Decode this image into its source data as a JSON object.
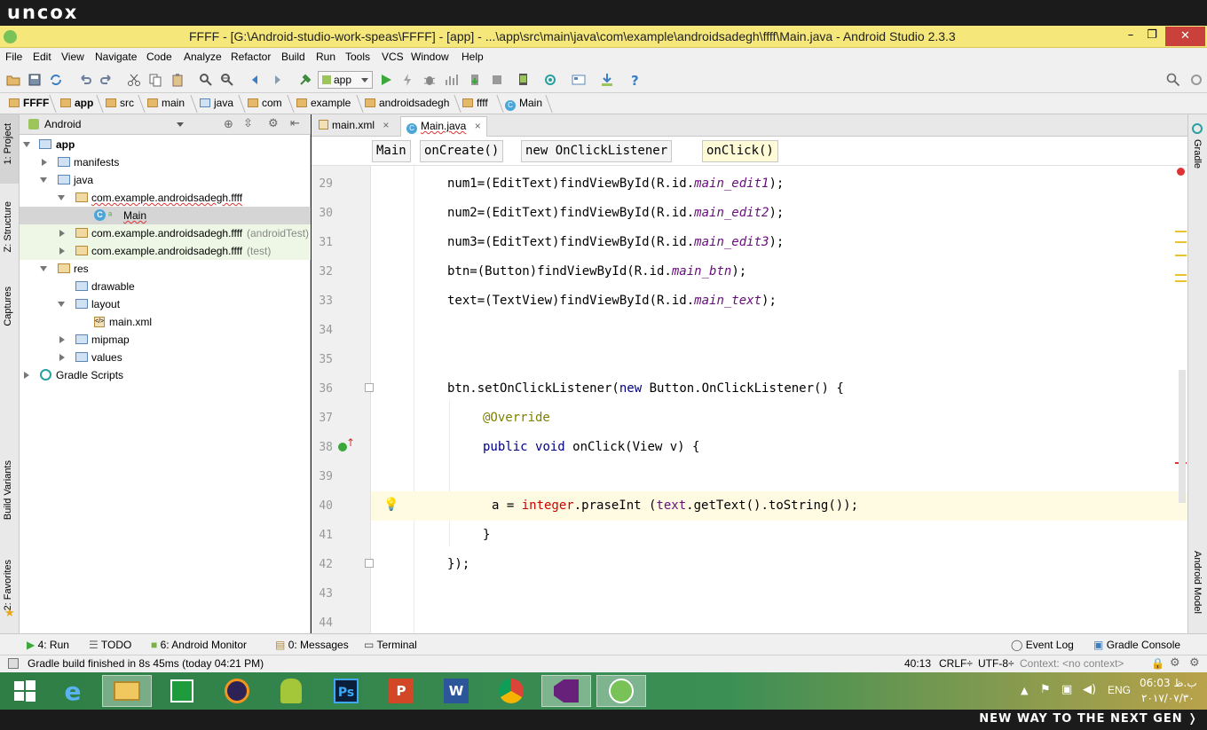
{
  "brand": {
    "logo": "uncox",
    "tagline": "NEW WAY TO THE NEXT GEN ❭"
  },
  "window": {
    "title": "FFFF - [G:\\Android-studio-work-speas\\FFFF] - [app] - ...\\app\\src\\main\\java\\com\\example\\androidsadegh\\ffff\\Main.java - Android Studio 2.3.3",
    "minimize": "–",
    "maximize": "❐",
    "close": "✕"
  },
  "menu": [
    "File",
    "Edit",
    "View",
    "Navigate",
    "Code",
    "Analyze",
    "Refactor",
    "Build",
    "Run",
    "Tools",
    "VCS",
    "Window",
    "Help"
  ],
  "toolbar": {
    "run_config": "app"
  },
  "nav_breadcrumb": [
    "FFFF",
    "app",
    "src",
    "main",
    "java",
    "com",
    "example",
    "androidsadegh",
    "ffff",
    "Main"
  ],
  "left_strip": {
    "project": "1: Project",
    "structure": "Z: Structure",
    "captures": "Captures",
    "build_variants": "Build Variants",
    "favorites": "2: Favorites"
  },
  "right_strip": {
    "gradle": "Gradle",
    "android_model": "Android Model"
  },
  "project_panel": {
    "view_mode": "Android",
    "tree": [
      {
        "label": "app",
        "suffix": ""
      },
      {
        "label": "manifests",
        "suffix": ""
      },
      {
        "label": "java",
        "suffix": ""
      },
      {
        "label": "com.example.androidsadegh.ffff",
        "suffix": ""
      },
      {
        "label": "Main",
        "suffix": ""
      },
      {
        "label": "com.example.androidsadegh.ffff",
        "suffix": "(androidTest)"
      },
      {
        "label": "com.example.androidsadegh.ffff",
        "suffix": "(test)"
      },
      {
        "label": "res",
        "suffix": ""
      },
      {
        "label": "drawable",
        "suffix": ""
      },
      {
        "label": "layout",
        "suffix": ""
      },
      {
        "label": "main.xml",
        "suffix": ""
      },
      {
        "label": "mipmap",
        "suffix": ""
      },
      {
        "label": "values",
        "suffix": ""
      },
      {
        "label": "Gradle Scripts",
        "suffix": ""
      }
    ]
  },
  "editor_tabs": [
    {
      "label": "main.xml",
      "close": "×"
    },
    {
      "label": "Main.java",
      "close": "×"
    }
  ],
  "code_breadcrumb": [
    "Main",
    "onCreate()",
    "new OnClickListener",
    "onClick()"
  ],
  "code": {
    "line_numbers": [
      "29",
      "30",
      "31",
      "32",
      "33",
      "34",
      "35",
      "36",
      "37",
      "38",
      "39",
      "40",
      "41",
      "42",
      "43",
      "44"
    ],
    "l29": {
      "a": "num1=(EditText)findViewById(R.id.",
      "b": "main_edit1",
      "c": ");"
    },
    "l30": {
      "a": "num2=(EditText)findViewById(R.id.",
      "b": "main_edit2",
      "c": ");"
    },
    "l31": {
      "a": "num3=(EditText)findViewById(R.id.",
      "b": "main_edit3",
      "c": ");"
    },
    "l32": {
      "a": "btn=(Button)findViewById(R.id.",
      "b": "main_btn",
      "c": ");"
    },
    "l33": {
      "a": "text=(TextView)findViewById(R.id.",
      "b": "main_text",
      "c": ");"
    },
    "l36": {
      "a": "btn.setOnClickListener(",
      "kw": "new",
      "b": " Button.OnClickListener() {"
    },
    "l37": "@Override",
    "l38": {
      "kw1": "public",
      "kw2": "void",
      "b": " onClick(View v) {"
    },
    "l40": {
      "a": "a = ",
      "err": "integer",
      "b": ".praseInt (",
      "var": "text",
      "c": ".getText().toString());"
    },
    "l41": "}",
    "l42": "});"
  },
  "bottom_tabs": {
    "run": "4: Run",
    "todo": "TODO",
    "monitor": "6: Android Monitor",
    "messages": "0: Messages",
    "terminal": "Terminal",
    "event_log": "Event Log",
    "gradle_console": "Gradle Console"
  },
  "status": {
    "message": "Gradle build finished in 8s 45ms (today 04:21 PM)",
    "position": "40:13",
    "line_sep": "CRLF÷",
    "encoding": "UTF-8÷",
    "context": "Context: <no context>"
  },
  "taskbar": {
    "lang": "ENG",
    "time": "06:03 ب.ظ",
    "date": "۲۰۱۷/۰۷/۳۰"
  },
  "colors": {
    "title_bg": "#f5e77a",
    "keyword": "#000080",
    "field": "#660e7a",
    "annotation": "#808000",
    "error": "#cc0000"
  }
}
